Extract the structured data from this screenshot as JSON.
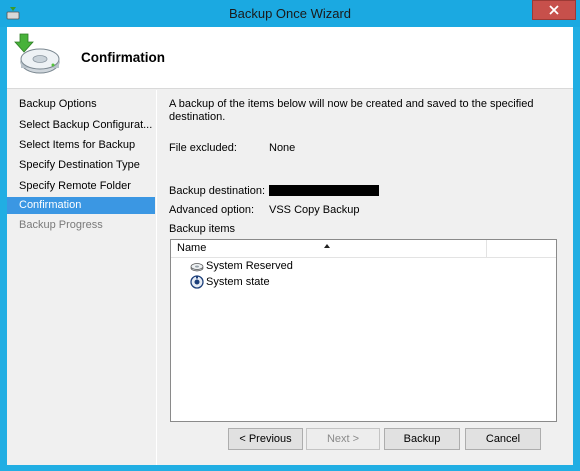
{
  "window": {
    "title": "Backup Once Wizard",
    "close_glyph": "✕"
  },
  "header": {
    "title": "Confirmation"
  },
  "nav": {
    "items": [
      {
        "label": "Backup Options",
        "state": "normal"
      },
      {
        "label": "Select Backup Configurat...",
        "state": "normal"
      },
      {
        "label": "Select Items for Backup",
        "state": "normal"
      },
      {
        "label": "Specify Destination Type",
        "state": "normal"
      },
      {
        "label": "Specify Remote Folder",
        "state": "normal"
      },
      {
        "label": "Confirmation",
        "state": "selected"
      },
      {
        "label": "Backup Progress",
        "state": "disabled"
      }
    ]
  },
  "main": {
    "intro": "A backup of the items below will now be created and saved to the specified destination.",
    "file_excluded_label": "File excluded:",
    "file_excluded_value": "None",
    "destination_label": "Backup destination:",
    "advanced_label": "Advanced option:",
    "advanced_value": "VSS Copy Backup",
    "items_label": "Backup items",
    "list": {
      "column": "Name",
      "rows": [
        {
          "label": "System Reserved",
          "icon": "drive-icon"
        },
        {
          "label": "System state",
          "icon": "system-state-icon"
        }
      ]
    }
  },
  "buttons": {
    "previous": "< Previous",
    "next": "Next >",
    "backup": "Backup",
    "cancel": "Cancel"
  },
  "colors": {
    "frame": "#1ba9e1",
    "selected": "#3b97e3",
    "close": "#c7504b"
  }
}
